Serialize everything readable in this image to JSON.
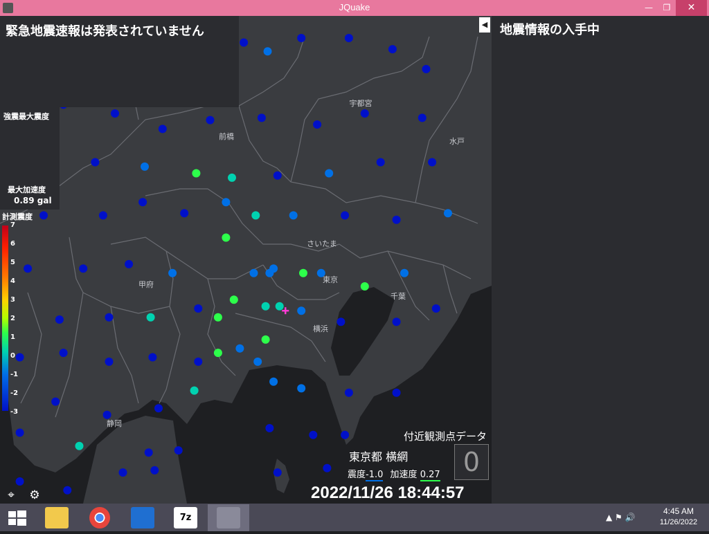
{
  "window": {
    "title": "JQuake",
    "minimize_glyph": "—",
    "restore_glyph": "❐",
    "close_glyph": "✕"
  },
  "eew": {
    "message": "緊急地震速報は発表されていません"
  },
  "sidebar": {
    "status": "地震情報の入手中",
    "collapse_glyph": "◀"
  },
  "max_intensity": {
    "label": "強震最大震度"
  },
  "max_accel": {
    "label": "最大加速度",
    "value": "0.89 gal"
  },
  "scale": {
    "title": "計測震度",
    "ticks": [
      "7",
      "6",
      "5",
      "4",
      "3",
      "2",
      "1",
      "0",
      "-1",
      "-2",
      "-3"
    ],
    "colors": {
      "7": "#c0001a",
      "6": "#ff1f00",
      "5": "#ff7a00",
      "4": "#ffb000",
      "3": "#ffe000",
      "2": "#b2ff00",
      "1": "#5fff2a",
      "0": "#2dff4b",
      "-1": "#00d2b0",
      "-2": "#0070e6",
      "-3": "#0010c8"
    }
  },
  "map": {
    "cities": [
      {
        "name": "前橋"
      },
      {
        "name": "宇都宮"
      },
      {
        "name": "水戸"
      },
      {
        "name": "さいたま"
      },
      {
        "name": "甲府"
      },
      {
        "name": "東京"
      },
      {
        "name": "千葉"
      },
      {
        "name": "横浜"
      },
      {
        "name": "静岡"
      }
    ],
    "stations": [
      {
        "level": -3,
        "lon": 138.67,
        "lat": 36.92
      },
      {
        "level": -3,
        "lon": 138.86,
        "lat": 36.93
      },
      {
        "level": -3,
        "lon": 139.07,
        "lat": 36.86
      },
      {
        "level": -3,
        "lon": 139.32,
        "lat": 36.93
      },
      {
        "level": -3,
        "lon": 139.53,
        "lat": 36.9
      },
      {
        "level": -2,
        "lon": 139.65,
        "lat": 36.86
      },
      {
        "level": -3,
        "lon": 139.82,
        "lat": 36.92
      },
      {
        "level": -3,
        "lon": 140.06,
        "lat": 36.92
      },
      {
        "level": -3,
        "lon": 140.28,
        "lat": 36.87
      },
      {
        "level": -3,
        "lon": 140.45,
        "lat": 36.78
      },
      {
        "level": -3,
        "lon": 138.62,
        "lat": 36.62
      },
      {
        "level": -3,
        "lon": 138.88,
        "lat": 36.58
      },
      {
        "level": -3,
        "lon": 139.12,
        "lat": 36.51
      },
      {
        "level": -3,
        "lon": 139.36,
        "lat": 36.55
      },
      {
        "level": -3,
        "lon": 139.62,
        "lat": 36.56
      },
      {
        "level": -3,
        "lon": 139.9,
        "lat": 36.53
      },
      {
        "level": -3,
        "lon": 140.14,
        "lat": 36.58
      },
      {
        "level": -3,
        "lon": 140.43,
        "lat": 36.56
      },
      {
        "level": -3,
        "lon": 138.52,
        "lat": 36.4
      },
      {
        "level": -3,
        "lon": 138.78,
        "lat": 36.36
      },
      {
        "level": -2,
        "lon": 139.03,
        "lat": 36.34
      },
      {
        "level": 0,
        "lon": 139.29,
        "lat": 36.31
      },
      {
        "level": -1,
        "lon": 139.47,
        "lat": 36.29
      },
      {
        "level": -3,
        "lon": 139.7,
        "lat": 36.3
      },
      {
        "level": -2,
        "lon": 139.96,
        "lat": 36.31
      },
      {
        "level": -3,
        "lon": 140.22,
        "lat": 36.36
      },
      {
        "level": -3,
        "lon": 140.48,
        "lat": 36.36
      },
      {
        "level": -3,
        "lon": 138.52,
        "lat": 36.12
      },
      {
        "level": -3,
        "lon": 138.82,
        "lat": 36.12
      },
      {
        "level": -3,
        "lon": 139.02,
        "lat": 36.18
      },
      {
        "level": -3,
        "lon": 139.23,
        "lat": 36.13
      },
      {
        "level": -2,
        "lon": 139.44,
        "lat": 36.18
      },
      {
        "level": -1,
        "lon": 139.59,
        "lat": 36.12
      },
      {
        "level": -2,
        "lon": 139.78,
        "lat": 36.12
      },
      {
        "level": -3,
        "lon": 140.04,
        "lat": 36.12
      },
      {
        "level": -3,
        "lon": 140.3,
        "lat": 36.1
      },
      {
        "level": -2,
        "lon": 140.56,
        "lat": 36.13
      },
      {
        "level": -3,
        "lon": 138.44,
        "lat": 35.88
      },
      {
        "level": -3,
        "lon": 138.72,
        "lat": 35.88
      },
      {
        "level": -3,
        "lon": 138.95,
        "lat": 35.9
      },
      {
        "level": -2,
        "lon": 139.17,
        "lat": 35.86
      },
      {
        "level": 0,
        "lon": 139.44,
        "lat": 36.02
      },
      {
        "level": -2,
        "lon": 139.58,
        "lat": 35.86
      },
      {
        "level": -2,
        "lon": 139.66,
        "lat": 35.86
      },
      {
        "level": -2,
        "lon": 139.68,
        "lat": 35.88
      },
      {
        "level": 0,
        "lon": 139.83,
        "lat": 35.86
      },
      {
        "level": -2,
        "lon": 139.92,
        "lat": 35.86
      },
      {
        "level": 0,
        "lon": 140.14,
        "lat": 35.8
      },
      {
        "level": -2,
        "lon": 140.34,
        "lat": 35.86
      },
      {
        "level": -3,
        "lon": 138.6,
        "lat": 35.65
      },
      {
        "level": -3,
        "lon": 138.85,
        "lat": 35.66
      },
      {
        "level": -1,
        "lon": 139.06,
        "lat": 35.66
      },
      {
        "level": -3,
        "lon": 139.3,
        "lat": 35.7
      },
      {
        "level": 0,
        "lon": 139.48,
        "lat": 35.74
      },
      {
        "level": -1,
        "lon": 139.64,
        "lat": 35.71
      },
      {
        "level": -1,
        "lon": 139.71,
        "lat": 35.71
      },
      {
        "level": -2,
        "lon": 139.82,
        "lat": 35.69
      },
      {
        "level": -3,
        "lon": 140.02,
        "lat": 35.64
      },
      {
        "level": -3,
        "lon": 140.3,
        "lat": 35.64
      },
      {
        "level": -3,
        "lon": 140.5,
        "lat": 35.7
      },
      {
        "level": 0,
        "lon": 139.4,
        "lat": 35.66
      },
      {
        "level": 0,
        "lon": 139.64,
        "lat": 35.56
      },
      {
        "level": 0,
        "lon": 139.4,
        "lat": 35.5
      },
      {
        "level": -2,
        "lon": 139.51,
        "lat": 35.52
      },
      {
        "level": -2,
        "lon": 139.6,
        "lat": 35.46
      },
      {
        "level": -3,
        "lon": 139.3,
        "lat": 35.46
      },
      {
        "level": -3,
        "lon": 139.07,
        "lat": 35.48
      },
      {
        "level": -3,
        "lon": 138.85,
        "lat": 35.46
      },
      {
        "level": -3,
        "lon": 138.62,
        "lat": 35.5
      },
      {
        "level": -3,
        "lon": 138.4,
        "lat": 35.48
      },
      {
        "level": -3,
        "lon": 138.58,
        "lat": 35.28
      },
      {
        "level": -3,
        "lon": 138.84,
        "lat": 35.22
      },
      {
        "level": -3,
        "lon": 139.1,
        "lat": 35.25
      },
      {
        "level": -1,
        "lon": 139.28,
        "lat": 35.33
      },
      {
        "level": -2,
        "lon": 139.68,
        "lat": 35.37
      },
      {
        "level": -2,
        "lon": 139.82,
        "lat": 35.34
      },
      {
        "level": -3,
        "lon": 140.06,
        "lat": 35.32
      },
      {
        "level": -3,
        "lon": 140.3,
        "lat": 35.32
      },
      {
        "level": -3,
        "lon": 138.4,
        "lat": 35.14
      },
      {
        "level": -1,
        "lon": 138.7,
        "lat": 35.08
      },
      {
        "level": -3,
        "lon": 139.05,
        "lat": 35.05
      },
      {
        "level": -3,
        "lon": 139.2,
        "lat": 35.06
      },
      {
        "level": -3,
        "lon": 139.66,
        "lat": 35.16
      },
      {
        "level": -3,
        "lon": 139.88,
        "lat": 35.13
      },
      {
        "level": -3,
        "lon": 140.04,
        "lat": 35.13
      },
      {
        "level": -3,
        "lon": 138.92,
        "lat": 34.96
      },
      {
        "level": -3,
        "lon": 139.08,
        "lat": 34.97
      },
      {
        "level": -3,
        "lon": 138.4,
        "lat": 34.92
      },
      {
        "level": -3,
        "lon": 138.64,
        "lat": 34.88
      },
      {
        "level": -3,
        "lon": 138.86,
        "lat": 34.8
      },
      {
        "level": -3,
        "lon": 139.7,
        "lat": 34.96
      },
      {
        "level": -3,
        "lon": 139.95,
        "lat": 34.98
      }
    ],
    "marker": {
      "lon": 139.74,
      "lat": 35.69
    }
  },
  "nearby": {
    "header": "付近観測点データ",
    "station": "東京都 横網",
    "intensity_label": "震度",
    "intensity_value": "-1.0",
    "accel_label": "加速度",
    "accel_value": "0.27",
    "box_value": "0"
  },
  "clock": {
    "datetime": "2022/11/26 18:44:57"
  },
  "taskbar": {
    "apps": [
      {
        "name": "start-button",
        "color": "#ffffff"
      },
      {
        "name": "file-explorer-icon",
        "color": "#f2c94c"
      },
      {
        "name": "chrome-icon",
        "color": "#e8453c"
      },
      {
        "name": "windows-defender-icon",
        "color": "#1f6fd1"
      },
      {
        "name": "7zip-icon",
        "color": "#ffffff"
      },
      {
        "name": "jquake-icon",
        "color": "#8a8a9a"
      }
    ],
    "tray": "▲  ⚑  🔊",
    "time": "4:45 AM",
    "date": "11/26/2022"
  }
}
